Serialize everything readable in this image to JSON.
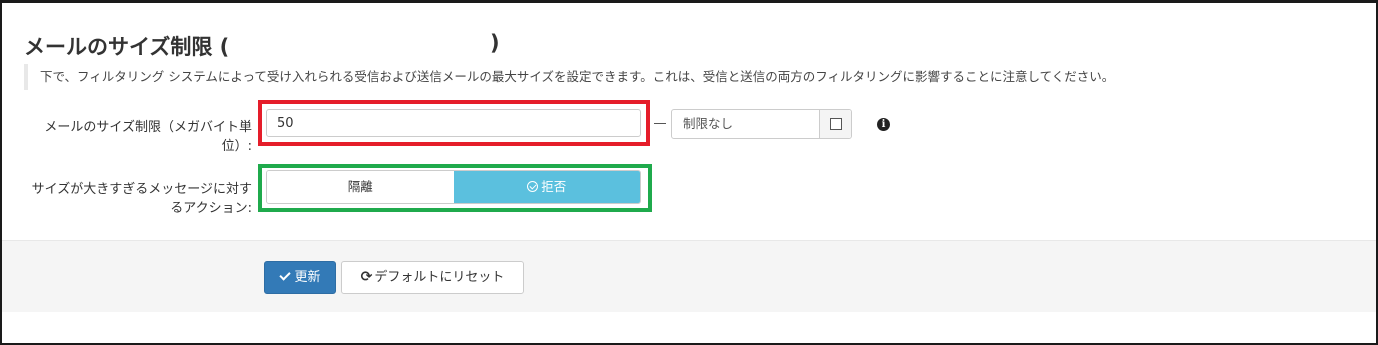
{
  "page": {
    "title": "メールのサイズ制限 (",
    "title_close": ")",
    "description": "下で、フィルタリング システムによって受け入れられる受信および送信メールの最大サイズを設定できます。これは、受信と送信の両方のフィルタリングに影響することに注意してください。"
  },
  "size_limit": {
    "label_line1": "メールのサイズ制限（メガバイト単",
    "label_line2": "位）:",
    "value": "50",
    "unlimited_label": "制限なし",
    "unlimited_checked": false,
    "info_icon": "info-circle-icon"
  },
  "action": {
    "label_line1": "サイズが大きすぎるメッセージに対す",
    "label_line2": "るアクション:",
    "options": [
      {
        "label": "隔離",
        "selected": false
      },
      {
        "label": "拒否",
        "selected": true
      }
    ]
  },
  "buttons": {
    "update": "更新",
    "reset": "デフォルトにリセット"
  },
  "colors": {
    "highlight_red": "#e51d2a",
    "highlight_green": "#1faa4c",
    "selected_option": "#5bc0de",
    "primary_button": "#337ab7"
  }
}
